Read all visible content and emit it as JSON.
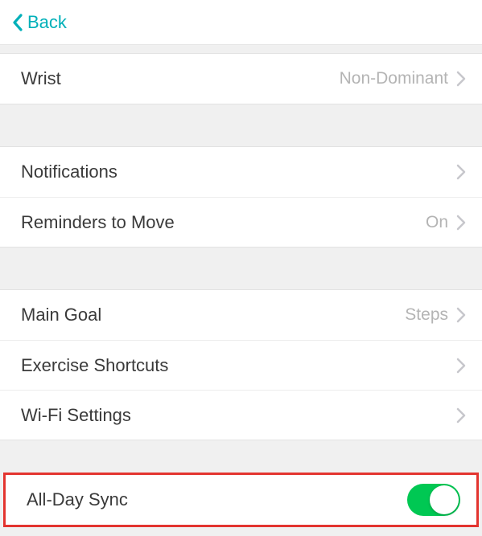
{
  "header": {
    "back_label": "Back"
  },
  "group1": {
    "wrist": {
      "label": "Wrist",
      "value": "Non-Dominant"
    }
  },
  "group2": {
    "notifications": {
      "label": "Notifications"
    },
    "reminders": {
      "label": "Reminders to Move",
      "value": "On"
    }
  },
  "group3": {
    "main_goal": {
      "label": "Main Goal",
      "value": "Steps"
    },
    "shortcuts": {
      "label": "Exercise Shortcuts"
    },
    "wifi": {
      "label": "Wi-Fi Settings"
    }
  },
  "group4": {
    "all_day_sync": {
      "label": "All-Day Sync",
      "on": true
    }
  },
  "colors": {
    "accent_teal": "#00b0b9",
    "toggle_green": "#00c853",
    "highlight_red": "#e3342f"
  }
}
